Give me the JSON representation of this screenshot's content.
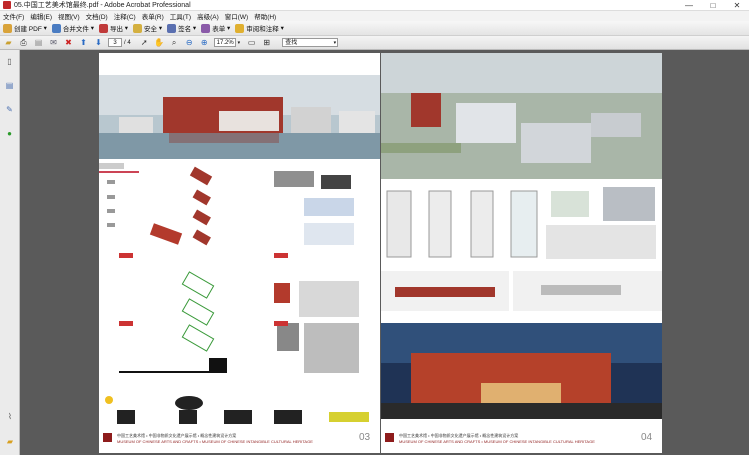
{
  "window": {
    "title": "05.中国工艺美术馆最终.pdf - Adobe Acrobat Professional",
    "controls": [
      "—",
      "□",
      "✕"
    ]
  },
  "menu": [
    "文件(F)",
    "编辑(E)",
    "视图(V)",
    "文档(D)",
    "注释(C)",
    "表单(R)",
    "工具(T)",
    "高级(A)",
    "窗口(W)",
    "帮助(H)"
  ],
  "toolbar": {
    "create_pdf": "创建 PDF",
    "merge_files": "合并文件",
    "export": "导出",
    "security": "安全",
    "sign": "签名",
    "forms": "表单",
    "review_comment": "审阅和注释"
  },
  "nav": {
    "current_page": "3",
    "total_pages": "/ 4",
    "zoom": "17.2%",
    "find_placeholder": "查找"
  },
  "pages": [
    {
      "number": "03",
      "footer_line1": "中国工艺美术馆 • 中国非物质文化遗产展示馆 • 概念性建筑设计方案",
      "footer_line2": "MUSEUM OF CHINESE ARTS AND CRAFTS • MUSEUM OF CHINESE INTANGIBLE CULTURAL HERITAGE"
    },
    {
      "number": "04",
      "footer_line1": "中国工艺美术馆 • 中国非物质文化遗产展示馆 • 概念性建筑设计方案",
      "footer_line2": "MUSEUM OF CHINESE ARTS AND CRAFTS • MUSEUM OF CHINESE INTANGIBLE CULTURAL HERITAGE"
    }
  ],
  "colors": {
    "brand_red": "#8e1c1c",
    "viewer_bg": "#5a5a5a"
  }
}
